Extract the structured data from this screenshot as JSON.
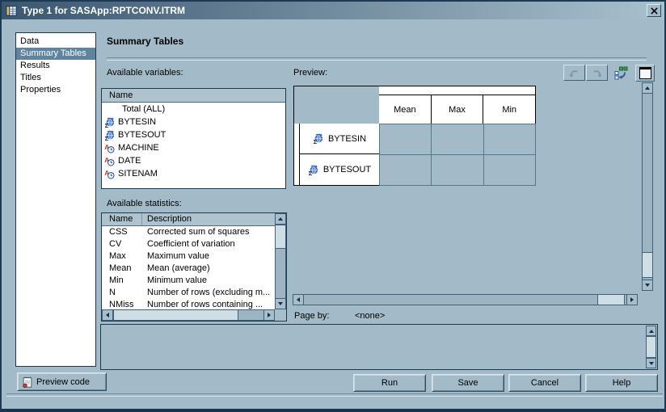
{
  "window": {
    "title": "Type 1 for SASApp:RPTCONV.ITRM",
    "icon": "table-icon",
    "close": "close-icon"
  },
  "sidebar": {
    "items": [
      {
        "label": "Data",
        "selected": false
      },
      {
        "label": "Summary Tables",
        "selected": true
      },
      {
        "label": "Results",
        "selected": false
      },
      {
        "label": "Titles",
        "selected": false
      },
      {
        "label": "Properties",
        "selected": false
      }
    ]
  },
  "main": {
    "heading": "Summary Tables"
  },
  "variables": {
    "label": "Available variables:",
    "header": "Name",
    "items": [
      {
        "label": "Total (ALL)",
        "icon": "none"
      },
      {
        "label": "BYTESIN",
        "icon": "numeric-variable-icon"
      },
      {
        "label": "BYTESOUT",
        "icon": "numeric-variable-icon"
      },
      {
        "label": "MACHINE",
        "icon": "character-variable-icon"
      },
      {
        "label": "DATE",
        "icon": "character-variable-icon"
      },
      {
        "label": "SITENAM",
        "icon": "character-variable-icon"
      }
    ]
  },
  "statistics": {
    "label": "Available statistics:",
    "columns": [
      "Name",
      "Description"
    ],
    "rows": [
      {
        "name": "CSS",
        "description": "Corrected sum of squares"
      },
      {
        "name": "CV",
        "description": "Coefficient of variation"
      },
      {
        "name": "Max",
        "description": "Maximum value"
      },
      {
        "name": "Mean",
        "description": "Mean (average)"
      },
      {
        "name": "Min",
        "description": "Minimum value"
      },
      {
        "name": "N",
        "description": "Number of rows (excluding m..."
      },
      {
        "name": "NMiss",
        "description": "Number of rows containing ..."
      }
    ]
  },
  "preview": {
    "label": "Preview:",
    "toolbar": {
      "icons": [
        "undo-icon",
        "redo-icon",
        "pivot-table-icon",
        "window-icon"
      ]
    },
    "table": {
      "column_headers": [
        "Mean",
        "Max",
        "Min"
      ],
      "rows": [
        {
          "label": "BYTESIN",
          "icon": "numeric-variable-icon"
        },
        {
          "label": "BYTESOUT",
          "icon": "numeric-variable-icon"
        }
      ]
    },
    "page_by": {
      "label": "Page by:",
      "value": "<none>"
    }
  },
  "footer": {
    "preview_code": "Preview code",
    "run": "Run",
    "save": "Save",
    "cancel": "Cancel",
    "help": "Help"
  },
  "colors": {
    "titlebar_start": "#3a5770",
    "titlebar_end": "#a9c0ce",
    "dialog_bg": "#a3bac8",
    "selection": "#5e849f",
    "grid_border": "#54788e"
  }
}
